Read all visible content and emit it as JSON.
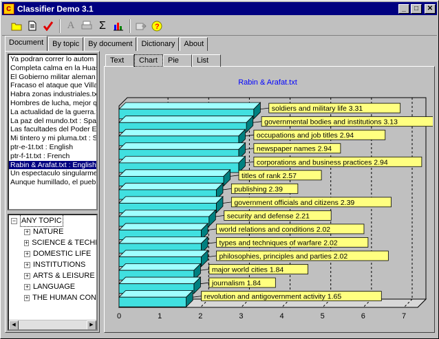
{
  "window": {
    "title": "Classifier Demo 3.1"
  },
  "title_buttons": {
    "minimize": "_",
    "maximize": "□",
    "close": "✕"
  },
  "toolbar": {
    "icons": [
      "open-folder-icon",
      "new-document-icon",
      "checkmark-icon",
      "font-icon",
      "print-icon",
      "sigma-icon",
      "bar-chart-icon",
      "export-icon",
      "help-icon"
    ],
    "glyphs": {
      "font": "A",
      "sigma": "Σ",
      "help": "?"
    }
  },
  "tabs": [
    {
      "label": "Document"
    },
    {
      "label": "By topic"
    },
    {
      "label": "By document"
    },
    {
      "label": "Dictionary"
    },
    {
      "label": "About"
    }
  ],
  "documents": [
    "Ya podran correr lo autom",
    "Completa calma en la Huas",
    "El Gobierno militar aleman a",
    "Fracaso el ataque que Villa",
    "Habra zonas industriales.txt",
    "Hombres de lucha, mejor qu",
    "La actualidad de la guerra.t",
    "La paz del mundo.txt : Span",
    "Las facultades del Poder E",
    "Mi tintero y mi pluma.txt : Sp",
    "ptr-e-1t.txt : English",
    "ptr-f-1t.txt : French",
    "Rabin & Arafat.txt : English",
    "Un espectaculo singularme",
    "Aunque humillado, el puebl"
  ],
  "selected_document_index": 12,
  "topics": {
    "root": "ANY TOPIC",
    "children": [
      "NATURE",
      "SCIENCE & TECHN",
      "DOMESTIC LIFE",
      "INSTITUTIONS",
      "ARTS & LEISURE",
      "LANGUAGE",
      "THE HUMAN CON"
    ]
  },
  "view_tabs": [
    {
      "label": "Text"
    },
    {
      "label": "Chart"
    },
    {
      "label": "Pie"
    },
    {
      "label": "List"
    }
  ],
  "chart_data": {
    "type": "bar",
    "orientation": "horizontal",
    "title": "Rabin & Arafat.txt",
    "categories": [
      "soldiers and military life",
      "governmental bodies and institutions",
      "occupations and job titles",
      "newspaper names",
      "corporations and business practices",
      "titles of rank",
      "publishing",
      "government officials and citizens",
      "security and defense",
      "world relations and conditions",
      "types and techniques of warfare",
      "philosophies, principles and parties",
      "major world cities",
      "journalism",
      "revolution and antigovernment activity"
    ],
    "values": [
      3.31,
      3.13,
      2.94,
      2.94,
      2.94,
      2.57,
      2.39,
      2.39,
      2.21,
      2.02,
      2.02,
      2.02,
      1.84,
      1.84,
      1.65
    ],
    "labels": [
      "soldiers and military life 3.31",
      "governmental bodies and institutions 3.13",
      "occupations and job titles 2.94",
      "newspaper names 2.94",
      "corporations and business practices 2.94",
      "titles of rank 2.57",
      "publishing 2.39",
      "government officials and citizens 2.39",
      "security and defense 2.21",
      "world relations and conditions 2.02",
      "types and techniques of warfare 2.02",
      "philosophies, principles and parties 2.02",
      "major world cities 1.84",
      "journalism 1.84",
      "revolution and antigovernment activity 1.65"
    ],
    "xlim": [
      0,
      7
    ],
    "xticks": [
      0,
      1,
      2,
      3,
      4,
      5,
      6,
      7
    ],
    "grid": true,
    "colors": {
      "bar_front": "#40e0e0",
      "bar_top": "#a0ffff",
      "bar_side": "#008080",
      "label_bg": "#ffff80",
      "title": "#0000ff",
      "plot_bg": "#c0c0c0"
    }
  }
}
